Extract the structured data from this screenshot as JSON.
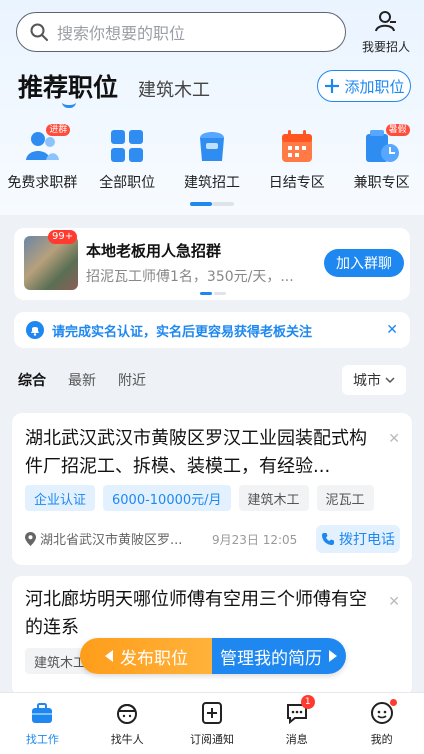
{
  "colors": {
    "accent": "#1e88f0",
    "orange": "#ff9d1a",
    "red": "#ff3b30"
  },
  "search": {
    "placeholder": "搜索你想要的职位"
  },
  "header": {
    "recruit_label": "我要招人",
    "tab_main": "推荐职位",
    "tab_sub": "建筑木工",
    "add_label": "添加职位"
  },
  "categories": [
    {
      "label": "免费求职群",
      "badge": "进群",
      "icon": "people-icon"
    },
    {
      "label": "全部职位",
      "icon": "grid-icon"
    },
    {
      "label": "建筑招工",
      "icon": "helmet-icon"
    },
    {
      "label": "日结专区",
      "icon": "calendar-icon"
    },
    {
      "label": "兼职专区",
      "badge": "暑假",
      "icon": "parttime-icon"
    }
  ],
  "group": {
    "badge": "99+",
    "title": "本地老板用人急招群",
    "desc": "招泥瓦工师傅1名，350元/天，...",
    "join_label": "加入群聊"
  },
  "notice": {
    "text": "请完成实名认证，实名后更容易获得老板关注"
  },
  "filters": {
    "items": [
      "综合",
      "最新",
      "附近"
    ],
    "city": "城市"
  },
  "jobs": [
    {
      "title": "湖北武汉武汉市黄陂区罗汉工业园装配式构件厂招泥工、拆模、装模工，有经验...",
      "tags": [
        "企业认证",
        "6000-10000元/月",
        "建筑木工",
        "泥瓦工"
      ],
      "address": "湖北省武汉市黄陂区罗...",
      "date": "9月23日 12:05",
      "call_label": "拨打电话"
    },
    {
      "title": "河北廊坊明天哪位师傅有空用三个师傅有空的连系",
      "tags": [
        "建筑木工"
      ]
    }
  ],
  "floatbar": {
    "publish_label": "发布职位",
    "resume_label": "管理我的简历"
  },
  "bottom_nav": [
    {
      "label": "找工作",
      "icon": "briefcase-icon"
    },
    {
      "label": "找牛人",
      "icon": "worker-icon"
    },
    {
      "label": "订阅通知",
      "icon": "subscribe-icon"
    },
    {
      "label": "消息",
      "icon": "message-icon",
      "badge": "1"
    },
    {
      "label": "我的",
      "icon": "profile-icon"
    }
  ]
}
